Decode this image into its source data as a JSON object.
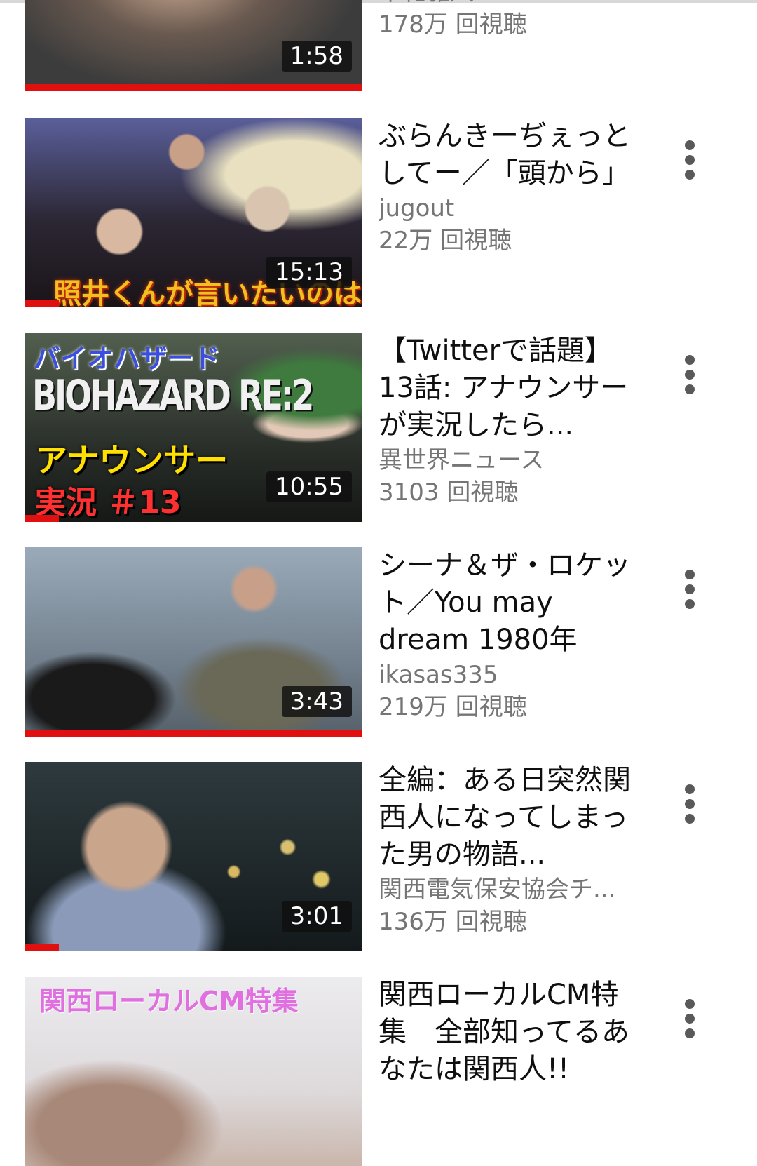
{
  "videos": [
    {
      "title": "",
      "channel": "牟礼雅八",
      "views": "178万 回視聴",
      "duration": "1:58",
      "progress": 1.0,
      "thumb_colors": [
        "#6b6b6b",
        "#3a3a3a"
      ],
      "overlay_text": ""
    },
    {
      "title": "ぶらんきーぢぇっとしてー／「頭から」",
      "channel": "jugout",
      "views": "22万 回視聴",
      "duration": "15:13",
      "progress": 0.1,
      "thumb_colors": [
        "#4a4f7a",
        "#2a2230"
      ],
      "overlay_text": "照井くんが言いたいのは"
    },
    {
      "title": "【Twitterで話題】13話: アナウンサーが実況したら...",
      "channel": "異世界ニュース",
      "views": "3103 回視聴",
      "duration": "10:55",
      "progress": 0.1,
      "thumb_colors": [
        "#3a4a3a",
        "#1a1f1a"
      ],
      "overlay_text": "バイオハザード",
      "overlay_text_2": "BIOHAZARD RE:2",
      "overlay_text_3": "アナウンサー",
      "overlay_text_4": "実況 ＃13"
    },
    {
      "title": "シーナ＆ザ・ロケット／You may dream 1980年",
      "channel": "ikasas335",
      "views": "219万 回視聴",
      "duration": "3:43",
      "progress": 1.0,
      "thumb_colors": [
        "#8a9aa8",
        "#4a5560"
      ],
      "overlay_text": ""
    },
    {
      "title": "全編：ある日突然関西人になってしまった男の物語...",
      "channel": "関西電気保安協会チ...",
      "views": "136万 回視聴",
      "duration": "3:01",
      "progress": 0.1,
      "thumb_colors": [
        "#2a3438",
        "#0d1214"
      ],
      "overlay_text": ""
    },
    {
      "title": "関西ローカルCM特集　全部知ってるあなたは関西人!!",
      "channel": "",
      "views": "",
      "duration": "",
      "progress": 0,
      "thumb_colors": [
        "#e8e6e8",
        "#c9b8b0"
      ],
      "overlay_text": "関西ローカルCM特集"
    }
  ],
  "icons": {
    "more": "more-vert-icon"
  },
  "colors": {
    "progress": "#e01010",
    "title": "#0f0f0f",
    "secondary": "#757575"
  }
}
